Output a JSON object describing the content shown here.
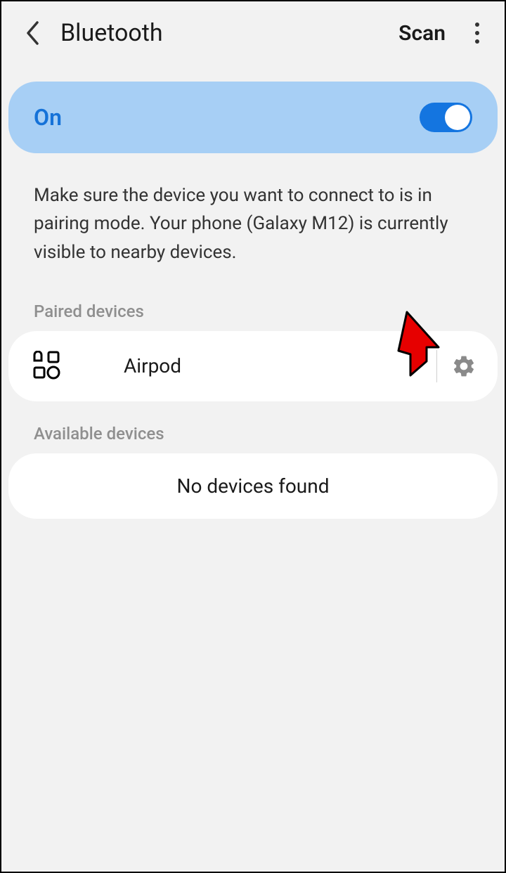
{
  "header": {
    "title": "Bluetooth",
    "scan_label": "Scan"
  },
  "status": {
    "state_label": "On",
    "toggle_on": true
  },
  "description_text": "Make sure the device you want to connect to is in pairing mode. Your phone (Galaxy M12) is currently visible to nearby devices.",
  "sections": {
    "paired_label": "Paired devices",
    "available_label": "Available devices",
    "no_devices_text": "No devices found"
  },
  "paired_devices": [
    {
      "name": "Airpod"
    }
  ]
}
